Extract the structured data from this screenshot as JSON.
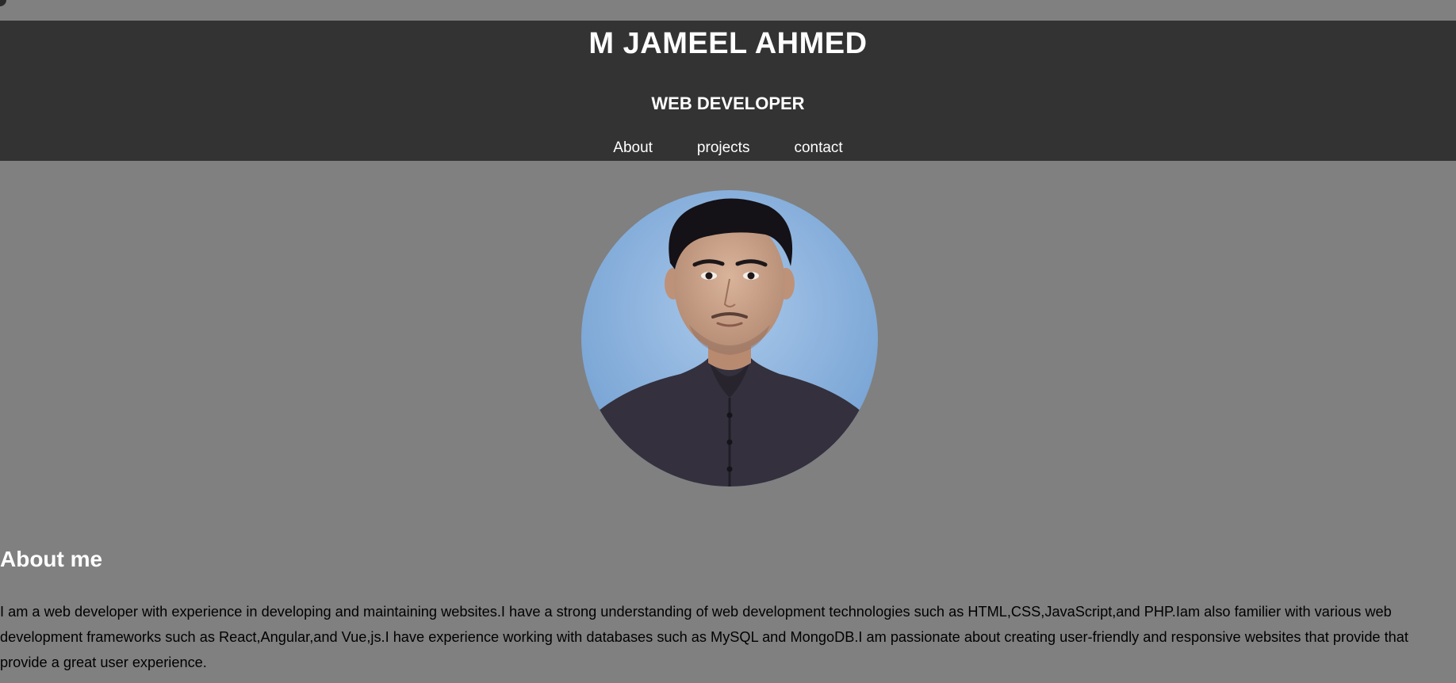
{
  "header": {
    "title": "M JAMEEL AHMED",
    "subtitle": "WEB DEVELOPER",
    "nav": [
      {
        "label": "About"
      },
      {
        "label": "projects"
      },
      {
        "label": "contact"
      }
    ]
  },
  "profile": {
    "photo_alt": "profile-photo"
  },
  "about": {
    "heading": "About me",
    "text": "I am a web developer with experience in developing and maintaining websites.I have a strong understanding of web development technologies such as HTML,CSS,JavaScript,and PHP.Iam also familier with various web development frameworks such as React,Angular,and Vue,js.I have experience working with databases such as MySQL and MongoDB.I am passionate about creating user-friendly and responsive websites that provide that provide a great user experience."
  },
  "colors": {
    "page_background": "#808080",
    "header_background": "#333333",
    "header_text": "#ffffff",
    "body_text": "#000000"
  }
}
